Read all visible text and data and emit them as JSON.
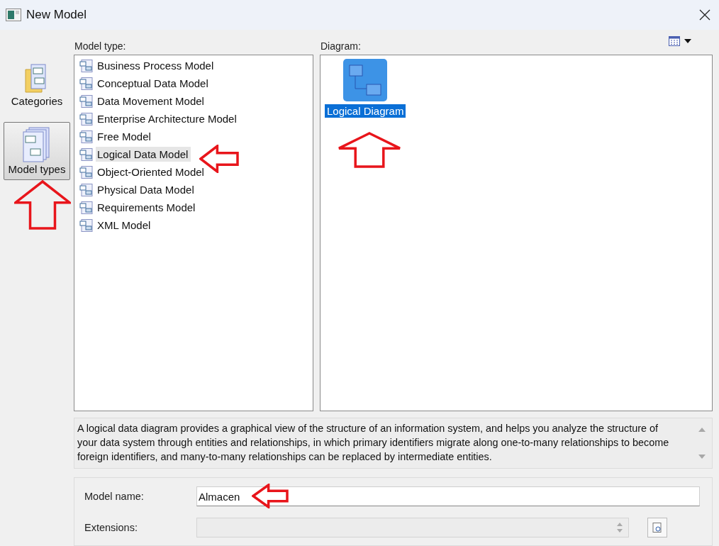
{
  "window": {
    "title": "New Model"
  },
  "sidebar": {
    "items": [
      {
        "label": "Categories",
        "selected": false
      },
      {
        "label": "Model types",
        "selected": true
      }
    ]
  },
  "model_type": {
    "label": "Model type:",
    "items": [
      {
        "label": "Business Process Model",
        "selected": false
      },
      {
        "label": "Conceptual Data Model",
        "selected": false
      },
      {
        "label": "Data Movement Model",
        "selected": false
      },
      {
        "label": "Enterprise Architecture Model",
        "selected": false
      },
      {
        "label": "Free Model",
        "selected": false
      },
      {
        "label": "Logical Data Model",
        "selected": true
      },
      {
        "label": "Object-Oriented Model",
        "selected": false
      },
      {
        "label": "Physical Data Model",
        "selected": false
      },
      {
        "label": "Requirements Model",
        "selected": false
      },
      {
        "label": "XML Model",
        "selected": false
      }
    ]
  },
  "diagram": {
    "label": "Diagram:",
    "items": [
      {
        "label": "Logical Diagram",
        "selected": true
      }
    ]
  },
  "description": "A logical data diagram provides a graphical view of the structure of an information system, and helps you analyze the structure of your data system through entities and relationships, in which primary identifiers migrate along one-to-many relationships to become foreign identifiers, and many-to-many relationships can be replaced by intermediate entities.",
  "form": {
    "model_name": {
      "label": "Model name:",
      "value": "Almacen"
    },
    "extensions": {
      "label": "Extensions:",
      "disabled": true
    }
  }
}
